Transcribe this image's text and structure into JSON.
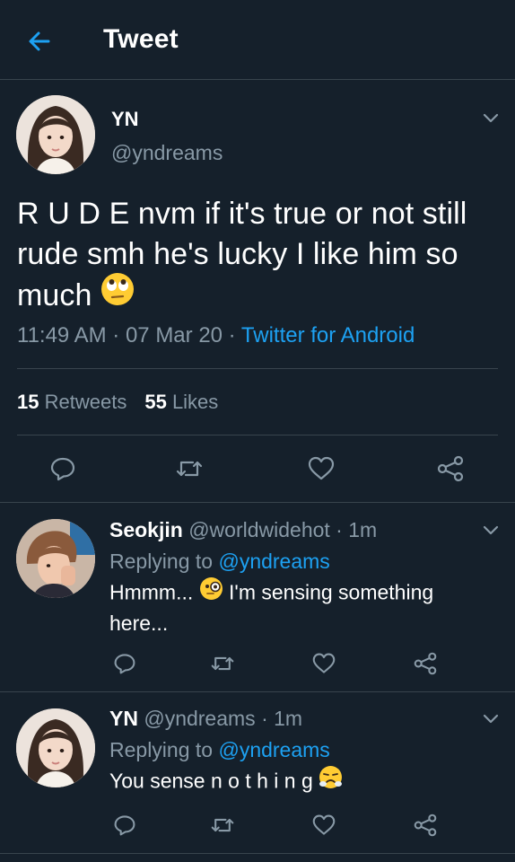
{
  "header": {
    "title": "Tweet"
  },
  "main_tweet": {
    "name": "YN",
    "handle": "@yndreams",
    "text": "R U D E nvm if it's true or not still rude smh he's lucky I like him so much",
    "emoji": "face-with-rolling-eyes",
    "time": "11:49 AM · 07 Mar 20 · ",
    "source": "Twitter for Android",
    "retweets_count": "15",
    "retweets_label": "Retweets",
    "likes_count": "55",
    "likes_label": "Likes"
  },
  "replies": [
    {
      "name": "Seokjin",
      "handle": "@worldwidehot",
      "time": " · 1m",
      "replying_prefix": "Replying to ",
      "replying_handle": "@yndreams",
      "text_before": "Hmmm... ",
      "emoji": "face-with-monocle",
      "text_after": " I'm sensing something here..."
    },
    {
      "name": "YN",
      "handle": "@yndreams",
      "time": " · 1m",
      "replying_prefix": "Replying to ",
      "replying_handle": "@yndreams",
      "text_before": "You sense n o t h i n g ",
      "emoji": "face-with-steam-from-nose"
    }
  ],
  "colors": {
    "background": "#15202b",
    "accent": "#1da1f2",
    "muted": "#8899a6",
    "border": "#38444d"
  }
}
